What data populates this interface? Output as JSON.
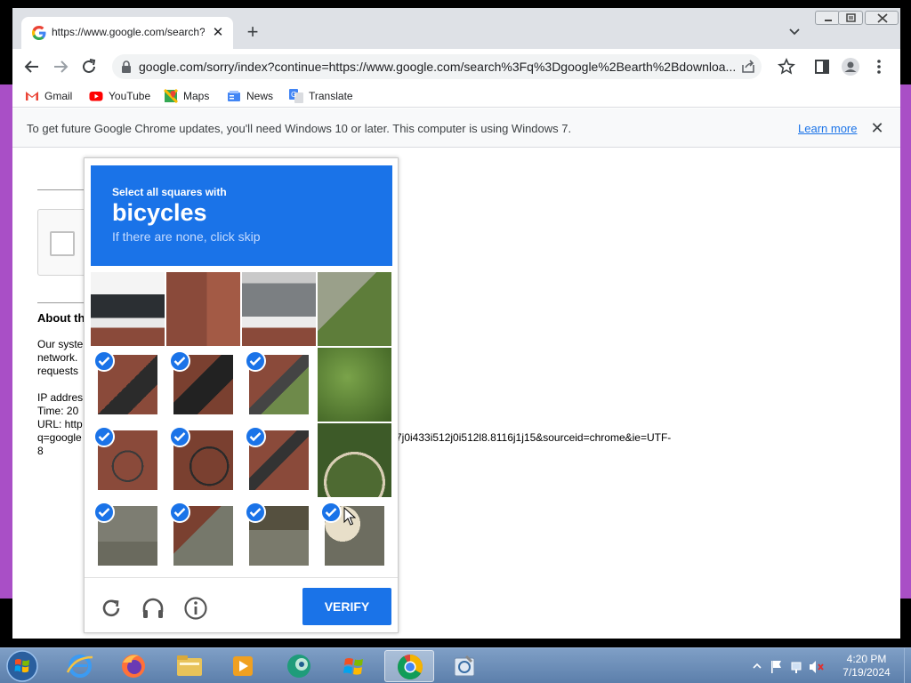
{
  "browser": {
    "tab_title": "https://www.google.com/search?",
    "url": "google.com/sorry/index?continue=https://www.google.com/search%3Fq%3Dgoogle%2Bearth%2Bdownloa...",
    "bookmarks": [
      {
        "label": "Gmail",
        "icon": "gmail-icon"
      },
      {
        "label": "YouTube",
        "icon": "youtube-icon"
      },
      {
        "label": "Maps",
        "icon": "maps-icon"
      },
      {
        "label": "News",
        "icon": "news-icon"
      },
      {
        "label": "Translate",
        "icon": "translate-icon"
      }
    ],
    "infobar": {
      "message": "To get future Google Chrome updates, you'll need Windows 10 or later. This computer is using Windows 7.",
      "learn_more": "Learn more"
    }
  },
  "page": {
    "about_heading": "About th",
    "lines_1": [
      "Our syste",
      "network.",
      "requests"
    ],
    "lines_2": [
      "IP addres",
      "Time: 20",
      "URL: http",
      "q=google",
      "8"
    ],
    "url_tail": "7j0i433i512j0i512l8.8116j1j15&sourceid=chrome&ie=UTF-"
  },
  "captcha": {
    "instruction": "Select all squares with",
    "target": "bicycles",
    "hint": "If there are none, click skip",
    "verify_label": "VERIFY",
    "selected": [
      [
        false,
        false,
        false,
        false
      ],
      [
        true,
        true,
        true,
        false
      ],
      [
        true,
        true,
        true,
        false
      ],
      [
        true,
        true,
        true,
        true
      ]
    ]
  },
  "taskbar": {
    "time": "4:20 PM",
    "date": "7/19/2024",
    "apps": [
      "internet-explorer-icon",
      "firefox-icon",
      "file-explorer-icon",
      "media-player-icon",
      "app-icon",
      "windows-flag-icon",
      "chrome-icon",
      "tools-icon"
    ]
  },
  "colors": {
    "accent": "#1a73e8",
    "desktop_side": "#a94fc6"
  }
}
